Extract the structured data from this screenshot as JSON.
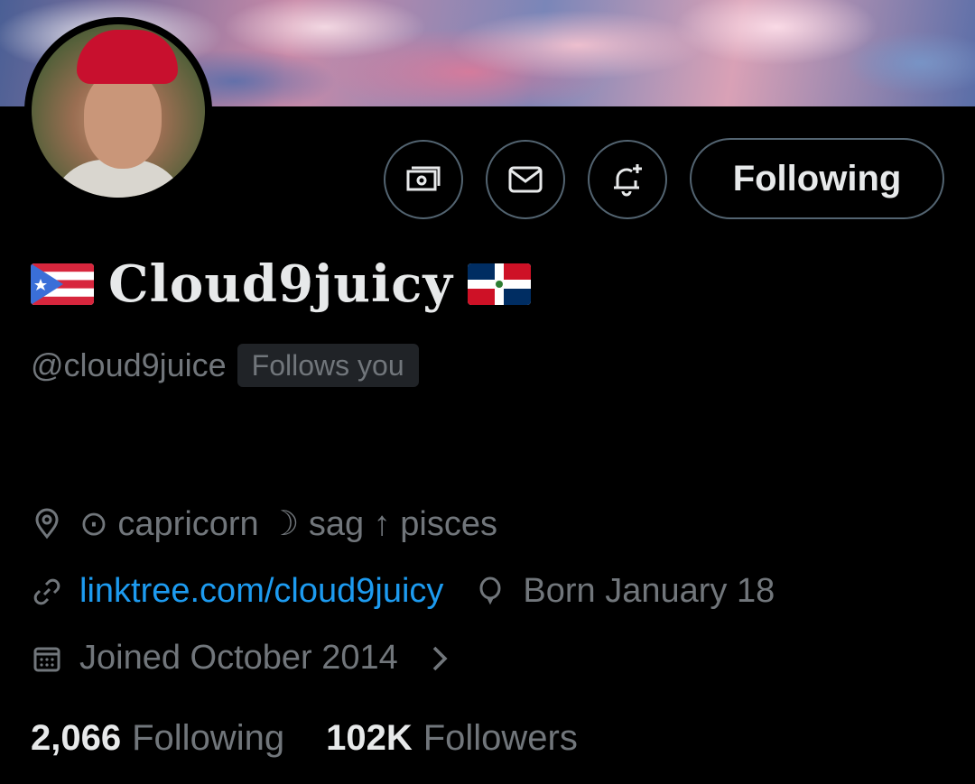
{
  "profile": {
    "display_name": "Cloud9juicy",
    "handle": "@cloud9juice",
    "follows_you_badge": "Follows you",
    "location": "⊙ capricorn ☽ sag ↑ pisces",
    "website": "linktree.com/cloud9juicy",
    "birthday": "Born January 18",
    "joined": "Joined October 2014"
  },
  "actions": {
    "following_label": "Following",
    "tip_icon": "money-icon",
    "message_icon": "mail-icon",
    "notify_icon": "bell-plus-icon"
  },
  "stats": {
    "following_count": "2,066",
    "following_label": "Following",
    "followers_count": "102K",
    "followers_label": "Followers"
  },
  "flags": {
    "left": "puerto-rico-flag-icon",
    "right": "dominican-republic-flag-icon"
  },
  "colors": {
    "background": "#000000",
    "text_primary": "#e7e9ea",
    "text_secondary": "#71767b",
    "link": "#1d9bf0",
    "border": "#536471"
  }
}
